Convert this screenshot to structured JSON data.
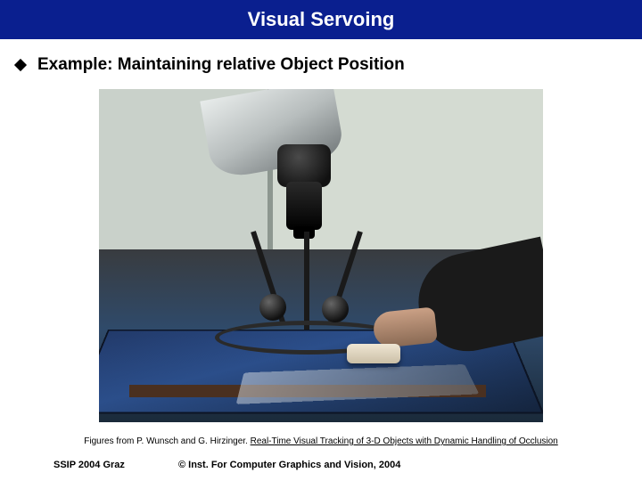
{
  "title": "Visual Servoing",
  "bullet": "Example: Maintaining relative Object Position",
  "caption_prefix": "Figures from P. Wunsch and G. Hirzinger. ",
  "caption_link": "Real-Time Visual Tracking of 3-D Objects with Dynamic Handling of Occlusion",
  "footer_left": "SSIP 2004 Graz",
  "footer_right": "© Inst. For Computer Graphics and Vision, 2004"
}
